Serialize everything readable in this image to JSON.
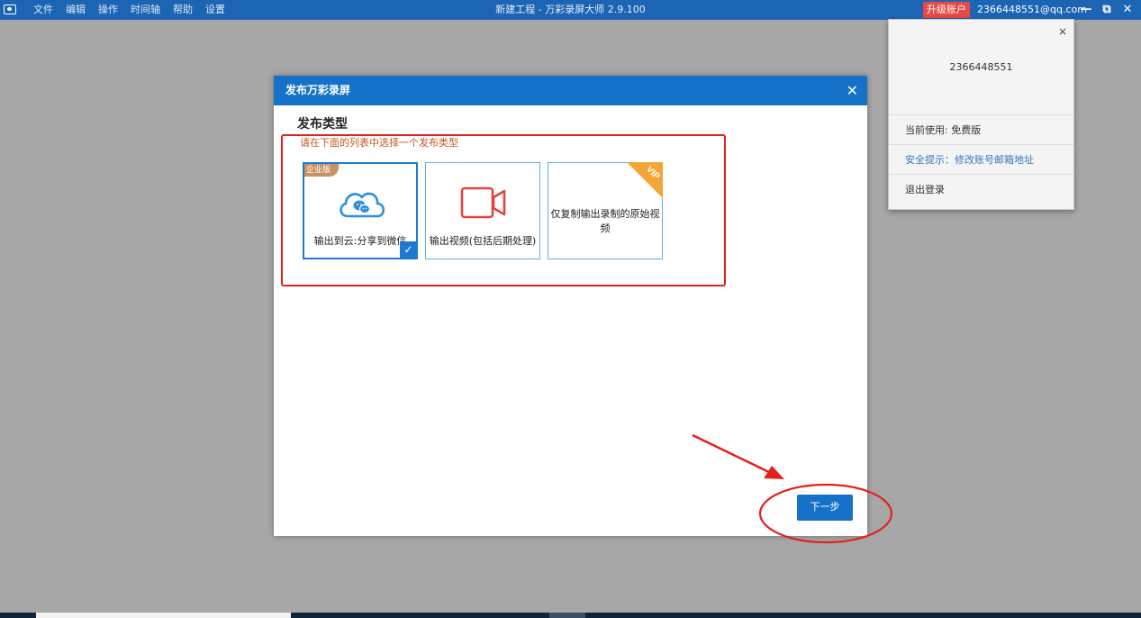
{
  "menu": [
    "文件",
    "编辑",
    "操作",
    "时间轴",
    "帮助",
    "设置"
  ],
  "window_title": "新建工程 - 万彩录屏大师 2.9.100",
  "upgrade_label": "升级账户",
  "account_email": "2366448551@qq.com",
  "window_controls": {
    "minimize": "—",
    "restore": "⧉",
    "close": "✕"
  },
  "account_panel": {
    "close": "×",
    "uid": "2366448551",
    "current_use": "当前使用: 免费版",
    "security_tip": "安全提示：修改账号邮箱地址",
    "logout": "退出登录"
  },
  "dialog": {
    "title": "发布万彩录屏",
    "close": "✕",
    "section_title": "发布类型",
    "hint": "请在下面的列表中选择一个发布类型",
    "options": [
      {
        "label": "输出到云:分享到微信",
        "badge": "企业版",
        "icon": "cloud-wechat-icon",
        "selected": true
      },
      {
        "label": "输出视频(包括后期处理)",
        "icon": "video-camera-icon",
        "selected": false
      },
      {
        "label": "仅复制输出录制的原始视频",
        "badge": "VIP",
        "icon": "none",
        "selected": false
      }
    ],
    "next_label": "下一步"
  },
  "colors": {
    "accent": "#1672c9",
    "title_bar": "#1c65b4",
    "upgrade": "#e64a45",
    "annotation_red": "#e3211c",
    "enterprise_badge": "#c89364",
    "vip_badge": "#f3a636"
  }
}
